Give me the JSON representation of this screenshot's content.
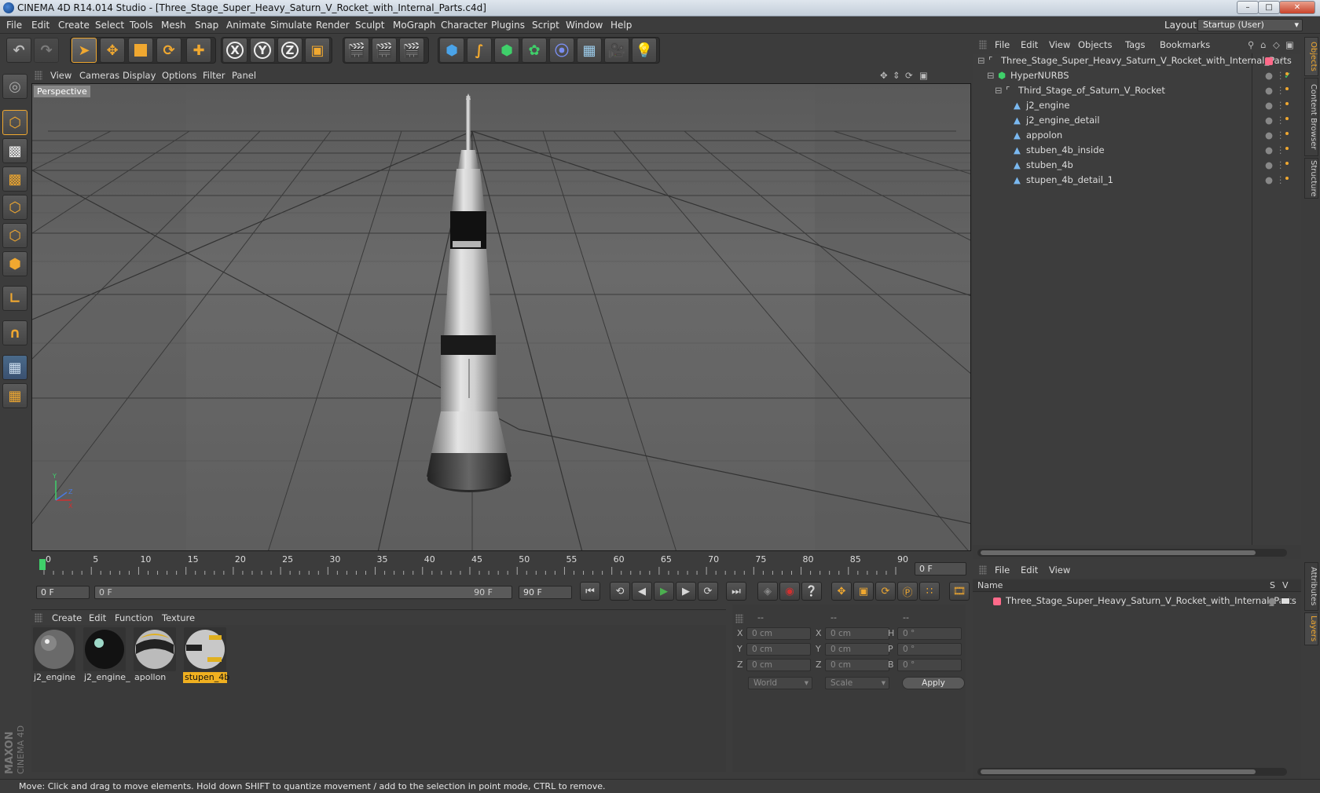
{
  "window": {
    "title": "CINEMA 4D R14.014 Studio - [Three_Stage_Super_Heavy_Saturn_V_Rocket_with_Internal_Parts.c4d]",
    "min": "–",
    "max": "□",
    "close": "✕"
  },
  "menu": [
    "File",
    "Edit",
    "Create",
    "Select",
    "Tools",
    "Mesh",
    "Snap",
    "Animate",
    "Simulate",
    "Render",
    "Sculpt",
    "MoGraph",
    "Character",
    "Plugins",
    "Script",
    "Window",
    "Help"
  ],
  "layout": {
    "label": "Layout:",
    "value": "Startup (User)"
  },
  "toolbar": {
    "x": "X",
    "y": "Y",
    "z": "Z"
  },
  "viewport": {
    "menu": [
      "View",
      "Cameras",
      "Display",
      "Options",
      "Filter",
      "Panel"
    ],
    "label": "Perspective"
  },
  "timeline": {
    "ticks": [
      "0",
      "5",
      "10",
      "15",
      "20",
      "25",
      "30",
      "35",
      "40",
      "45",
      "50",
      "55",
      "60",
      "65",
      "70",
      "75",
      "80",
      "85",
      "90"
    ],
    "current": "0 F",
    "start": "0 F",
    "range_start": "0 F",
    "range_end": "90 F",
    "end": "90 F"
  },
  "materials": {
    "menu": [
      "Create",
      "Edit",
      "Function",
      "Texture"
    ],
    "items": [
      {
        "name": "j2_engine",
        "selected": false
      },
      {
        "name": "j2_engine_",
        "selected": false
      },
      {
        "name": "apollon",
        "selected": false
      },
      {
        "name": "stupen_4b",
        "selected": true
      }
    ]
  },
  "coords": {
    "header": [
      "--",
      "--",
      "--"
    ],
    "rows": [
      {
        "a": "X",
        "av": "0 cm",
        "b": "X",
        "bv": "0 cm",
        "c": "H",
        "cv": "0 °"
      },
      {
        "a": "Y",
        "av": "0 cm",
        "b": "Y",
        "bv": "0 cm",
        "c": "P",
        "cv": "0 °"
      },
      {
        "a": "Z",
        "av": "0 cm",
        "b": "Z",
        "bv": "0 cm",
        "c": "B",
        "cv": "0 °"
      }
    ],
    "world": "World",
    "scale": "Scale",
    "apply": "Apply"
  },
  "objects": {
    "menu": [
      "File",
      "Edit",
      "View",
      "Objects",
      "Tags",
      "Bookmarks"
    ],
    "rows": [
      "Three_Stage_Super_Heavy_Saturn_V_Rocket_with_Internal_Parts",
      "HyperNURBS",
      "Third_Stage_of_Saturn_V_Rocket",
      "j2_engine",
      "j2_engine_detail",
      "appolon",
      "stuben_4b_inside",
      "stuben_4b",
      "stupen_4b_detail_1"
    ]
  },
  "layers": {
    "menu": [
      "File",
      "Edit",
      "View"
    ],
    "col_name": "Name",
    "col_s": "S",
    "col_v": "V",
    "rows": [
      "Three_Stage_Super_Heavy_Saturn_V_Rocket_with_Internal_Parts"
    ]
  },
  "sidetabs": {
    "right_top": [
      "Objects",
      "Content Browser",
      "Structure"
    ],
    "right_bottom": [
      "Attributes",
      "Layers"
    ],
    "brand": "MAXON CINEMA 4D"
  },
  "status": "Move: Click and drag to move elements. Hold down SHIFT to quantize movement / add to the selection in point mode, CTRL to remove.",
  "colors": {
    "accent": "#f0a830",
    "selection": "#f0b020",
    "bg": "#3c3c3c",
    "play": "#4caf50",
    "red": "#d03030"
  }
}
